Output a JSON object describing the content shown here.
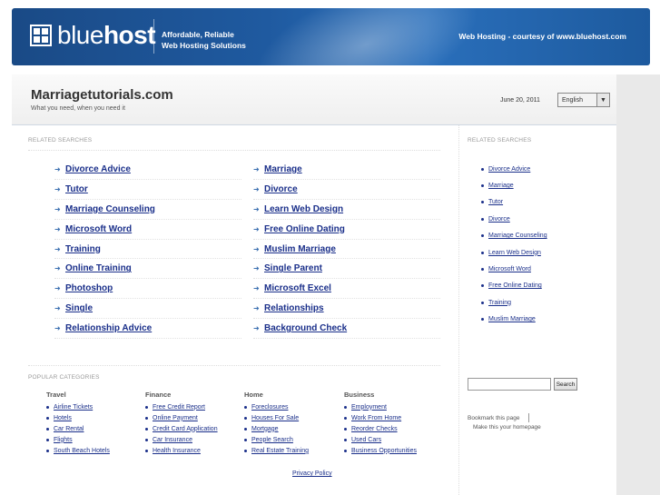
{
  "banner": {
    "logo_light": "blue",
    "logo_bold": "host",
    "tagline_line1": "Affordable, Reliable",
    "tagline_line2": "Web Hosting Solutions",
    "courtesy": "Web Hosting - courtesy of www.bluehost.com"
  },
  "header": {
    "title": "Marriagetutorials.com",
    "subtitle": "What you need, when you need it",
    "date": "June 20, 2011",
    "language": "English"
  },
  "related_label": "RELATED SEARCHES",
  "related_main": {
    "left": [
      "Divorce Advice",
      "Tutor",
      "Marriage Counseling",
      "Microsoft Word",
      "Training",
      "Online Training",
      "Photoshop",
      "Single",
      "Relationship Advice"
    ],
    "right": [
      "Marriage",
      "Divorce",
      "Learn Web Design",
      "Free Online Dating",
      "Muslim Marriage",
      "Single Parent",
      "Microsoft Excel",
      "Relationships",
      "Background Check"
    ]
  },
  "related_side_label": "RELATED SEARCHES",
  "related_side": [
    "Divorce Advice",
    "Marriage",
    "Tutor",
    "Divorce",
    "Marriage Counseling",
    "Learn Web Design",
    "Microsoft Word",
    "Free Online Dating",
    "Training",
    "Muslim Marriage"
  ],
  "popular_label": "POPULAR CATEGORIES",
  "categories": [
    {
      "name": "Travel",
      "items": [
        "Airline Tickets",
        "Hotels",
        "Car Rental",
        "Flights",
        "South Beach Hotels"
      ]
    },
    {
      "name": "Finance",
      "items": [
        "Free Credit Report",
        "Online Payment",
        "Credit Card Application",
        "Car Insurance",
        "Health Insurance"
      ]
    },
    {
      "name": "Home",
      "items": [
        "Foreclosures",
        "Houses For Sale",
        "Mortgage",
        "People Search",
        "Real Estate Training"
      ]
    },
    {
      "name": "Business",
      "items": [
        "Employment",
        "Work From Home",
        "Reorder Checks",
        "Used Cars",
        "Business Opportunities"
      ]
    }
  ],
  "search": {
    "button_label": "Search",
    "value": ""
  },
  "bookmark_label": "Bookmark this page",
  "homepage_label": "Make this your homepage",
  "privacy_label": "Privacy Policy",
  "colors": {
    "banner": "#1f5aa0",
    "link": "#1a2f8a",
    "arrow": "#3a6fb0"
  }
}
